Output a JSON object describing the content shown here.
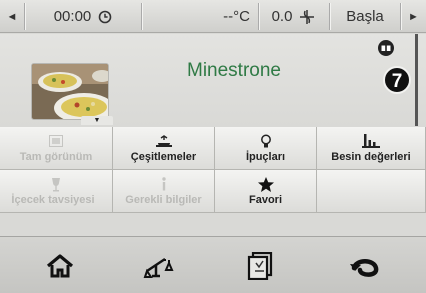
{
  "status_bar": {
    "left_arrow": "◄",
    "time": "00:00",
    "clock_icon": "clock-icon",
    "temperature": "--°C",
    "speed": "0.0",
    "fan_icon": "fan-icon",
    "start_label": "Başla",
    "right_arrow": "►"
  },
  "recipe": {
    "title": "Minestrone",
    "badge": "7",
    "book_icon": "book-icon"
  },
  "menu": {
    "row1": [
      {
        "label": "Tam görünüm",
        "icon": "full-view-icon",
        "enabled": false
      },
      {
        "label": "Çeşitlemeler",
        "icon": "variations-icon",
        "enabled": true
      },
      {
        "label": "İpuçları",
        "icon": "lightbulb-icon",
        "enabled": true
      },
      {
        "label": "Besin değerleri",
        "icon": "nutrition-chart-icon",
        "enabled": true
      }
    ],
    "row2": [
      {
        "label": "İçecek tavsiyesi",
        "icon": "wine-glass-icon",
        "enabled": false
      },
      {
        "label": "Gerekli bilgiler",
        "icon": "info-icon",
        "enabled": false
      },
      {
        "label": "Favori",
        "icon": "star-icon",
        "enabled": true
      },
      {
        "label": "",
        "icon": "",
        "enabled": false
      }
    ]
  },
  "bottom_bar": {
    "icons": [
      "home-icon",
      "scale-icon",
      "recipe-book-icon",
      "back-icon"
    ]
  },
  "colors": {
    "title_green": "#2f7a45",
    "disabled_text": "#b9b9b6"
  }
}
